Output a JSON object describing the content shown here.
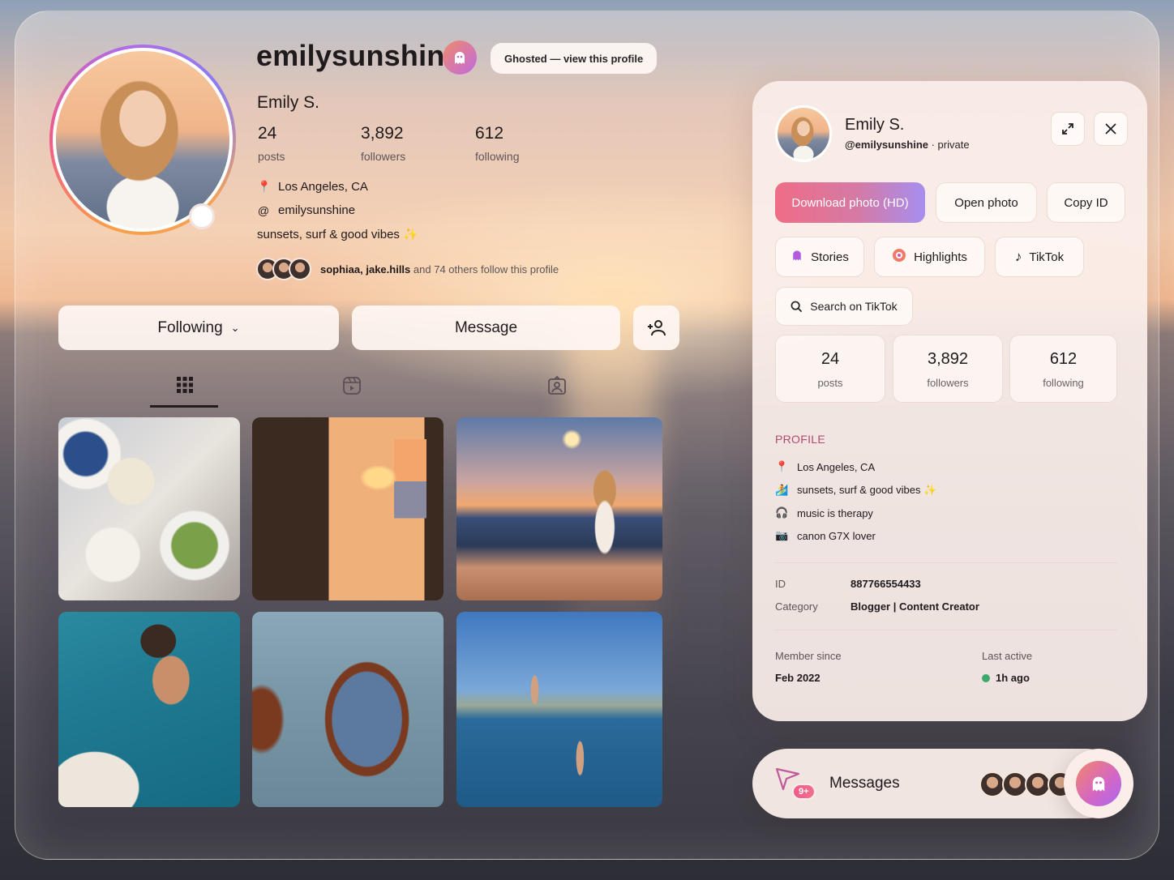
{
  "profile": {
    "username": "emilysunshine",
    "ghost_label": "Ghosted — view this profile",
    "full_name": "Emily S.",
    "stats": [
      {
        "value": "24",
        "label": "posts"
      },
      {
        "value": "3,892",
        "label": "followers"
      },
      {
        "value": "612",
        "label": "following"
      }
    ],
    "location": "Los Angeles, CA",
    "handle": "emilysunshine",
    "bio": "sunsets, surf & good vibes ✨",
    "mutual_names": "sophiaa, jake.hills",
    "mutual_rest": "and 74 others follow this profile"
  },
  "actions": {
    "following": "Following",
    "message": "Message"
  },
  "grid": {
    "tabs": [
      "posts-grid",
      "reels",
      "tagged"
    ],
    "tiles": [
      {
        "name": "tile-table-food"
      },
      {
        "name": "tile-window-sunset"
      },
      {
        "name": "tile-balcony-sunset"
      },
      {
        "name": "tile-swimmer"
      },
      {
        "name": "tile-sunglasses"
      },
      {
        "name": "tile-cliff-jump"
      }
    ]
  },
  "panel": {
    "name": "Emily S.",
    "handle": "@emilysunshine",
    "privacy": " · private",
    "buttons": {
      "download": "Download photo (HD)",
      "open": "Open photo",
      "copy": "Copy ID",
      "stories": "Stories",
      "highlights": "Highlights",
      "tiktok": "TikTok",
      "search": "Search on TikTok"
    },
    "stats": [
      {
        "value": "24",
        "label": "posts"
      },
      {
        "value": "3,892",
        "label": "followers"
      },
      {
        "value": "612",
        "label": "following"
      }
    ],
    "section_title": "PROFILE",
    "bio": [
      {
        "icon": "📍",
        "text": "Los Angeles, CA"
      },
      {
        "icon": "🏄",
        "text": "sunsets, surf & good vibes ✨"
      },
      {
        "icon": "🎧",
        "text": "music is therapy"
      },
      {
        "icon": "📷",
        "text": "canon G7X lover"
      }
    ],
    "id_label": "ID",
    "id_value": "887766554433",
    "category_label": "Category",
    "category_value": "Blogger | Content Creator",
    "member_since_label": "Member since",
    "member_since_value": "Feb 2022",
    "last_active_label": "Last active",
    "last_active_value": "1h ago"
  },
  "messages": {
    "label": "Messages",
    "badge": "9+"
  },
  "colors": {
    "accent_pink": "#ef6d86",
    "accent_purple": "#a68ef0",
    "section_title": "#b24a70",
    "online": "#3caa6a"
  }
}
